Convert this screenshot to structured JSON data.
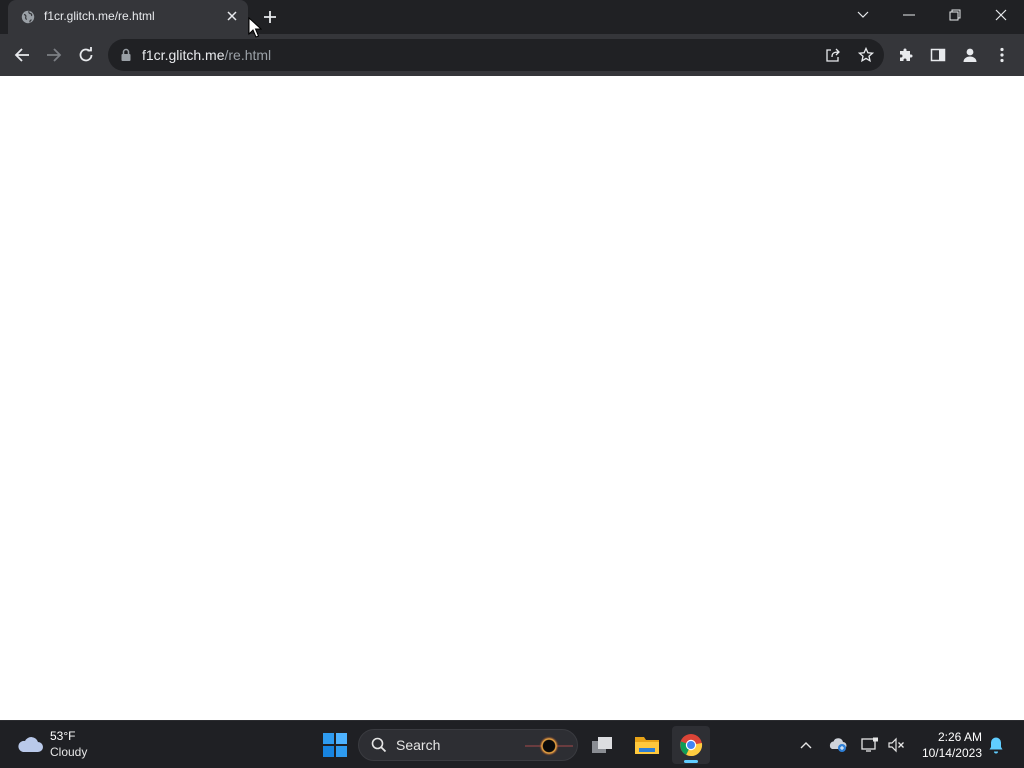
{
  "browser": {
    "tab": {
      "title": "f1cr.glitch.me/re.html",
      "favicon": "globe-icon"
    },
    "new_tab_icon": "plus-icon",
    "window_controls": [
      "chevron-down-icon",
      "minimize-icon",
      "restore-icon",
      "close-icon"
    ],
    "toolbar": {
      "back_icon": "arrow-left-icon",
      "forward_icon": "arrow-right-icon",
      "reload_icon": "reload-icon",
      "address": {
        "host": "f1cr.glitch.me",
        "path": "/re.html",
        "lock_icon": "lock-icon"
      },
      "share_icon": "share-icon",
      "bookmark_icon": "star-icon",
      "extensions_icon": "puzzle-icon",
      "sidepanel_icon": "side-panel-icon",
      "profile_icon": "person-icon",
      "menu_icon": "more-vert-icon"
    }
  },
  "taskbar": {
    "weather": {
      "temperature": "53°F",
      "condition": "Cloudy",
      "icon": "cloud-icon"
    },
    "search_label": "Search",
    "apps": [
      "windows-start-icon",
      "task-view-icon",
      "file-explorer-icon",
      "chrome-icon"
    ],
    "tray": [
      "chevron-up-icon",
      "onedrive-icon",
      "display-icon",
      "speaker-muted-icon",
      "bell-icon"
    ],
    "clock": {
      "time": "2:26 AM",
      "date": "10/14/2023"
    }
  },
  "colors": {
    "titlebar": "#202124",
    "toolbar": "#35363a",
    "taskbar": "#1f2024",
    "accent": "#60cdff"
  }
}
